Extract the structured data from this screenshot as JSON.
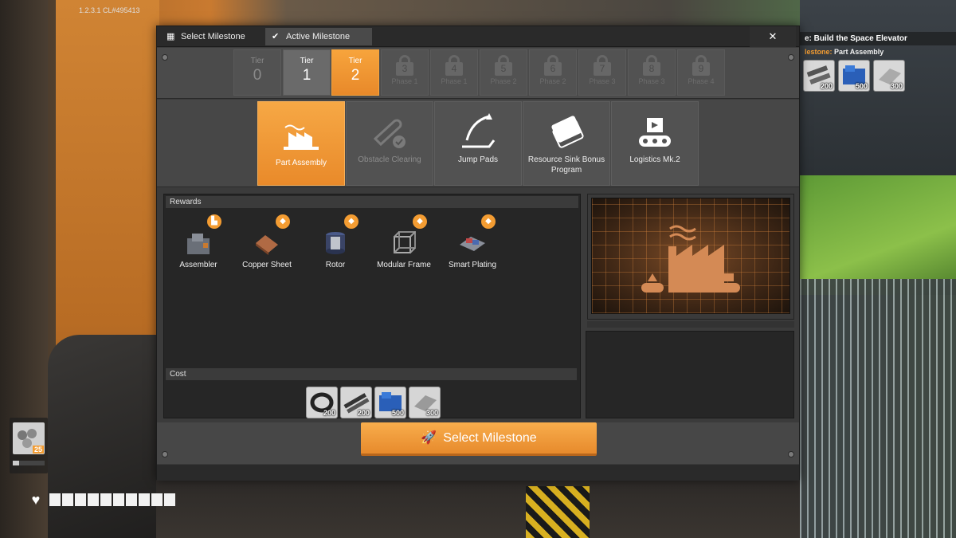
{
  "version": "1.2.3.1 CL#495413",
  "objective": {
    "title_prefix": "e: ",
    "title": "Build the Space Elevator",
    "sub_label": "lestone:",
    "sub_value": "Part Assembly",
    "items": [
      {
        "icon": "plates-icon",
        "count": "200"
      },
      {
        "icon": "crates-icon",
        "count": "500"
      },
      {
        "icon": "sheet-icon",
        "count": "300"
      }
    ]
  },
  "hand": {
    "count": "25",
    "icon": "pipes-icon"
  },
  "health": {
    "cells": 10,
    "filled": 10
  },
  "window": {
    "tabs": [
      {
        "label": "Select Milestone",
        "icon": "grid-icon"
      },
      {
        "label": "Active Milestone",
        "icon": "check-icon"
      }
    ],
    "close": "✕",
    "tiers": [
      {
        "label": "Tier",
        "number": "0",
        "state": "dim"
      },
      {
        "label": "Tier",
        "number": "1",
        "state": "unlocked"
      },
      {
        "label": "Tier",
        "number": "2",
        "state": "selected"
      },
      {
        "number": "3",
        "phase": "Phase 1",
        "state": "locked"
      },
      {
        "number": "4",
        "phase": "Phase 1",
        "state": "locked"
      },
      {
        "number": "5",
        "phase": "Phase 2",
        "state": "locked"
      },
      {
        "number": "6",
        "phase": "Phase 2",
        "state": "locked"
      },
      {
        "number": "7",
        "phase": "Phase 3",
        "state": "locked"
      },
      {
        "number": "8",
        "phase": "Phase 3",
        "state": "locked"
      },
      {
        "number": "9",
        "phase": "Phase 4",
        "state": "locked"
      }
    ],
    "milestones": [
      {
        "label": "Part Assembly",
        "icon": "factory-icon",
        "state": "selected"
      },
      {
        "label": "Obstacle Clearing",
        "icon": "chainsaw-icon",
        "state": "dim"
      },
      {
        "label": "Jump Pads",
        "icon": "jump-pad-icon",
        "state": "normal"
      },
      {
        "label": "Resource Sink Bonus Program",
        "icon": "coupon-icon",
        "state": "normal"
      },
      {
        "label": "Logistics Mk.2",
        "icon": "conveyor-icon",
        "state": "normal"
      }
    ],
    "rewards_header": "Rewards",
    "rewards": [
      {
        "label": "Assembler",
        "icon": "assembler-icon",
        "badge": "building-icon"
      },
      {
        "label": "Copper Sheet",
        "icon": "copper-sheet-icon",
        "badge": "part-icon"
      },
      {
        "label": "Rotor",
        "icon": "rotor-icon",
        "badge": "part-icon"
      },
      {
        "label": "Modular Frame",
        "icon": "modular-frame-icon",
        "badge": "part-icon"
      },
      {
        "label": "Smart Plating",
        "icon": "smart-plating-icon",
        "badge": "part-icon"
      }
    ],
    "cost_header": "Cost",
    "cost": [
      {
        "icon": "cable-icon",
        "count": "200"
      },
      {
        "icon": "rods-icon",
        "count": "200"
      },
      {
        "icon": "crates-icon",
        "count": "500"
      },
      {
        "icon": "sheet-icon",
        "count": "300"
      }
    ],
    "select_button": "Select Milestone"
  },
  "colors": {
    "accent": "#f39c32",
    "panel": "#3b3b3b",
    "dark": "#262626"
  }
}
